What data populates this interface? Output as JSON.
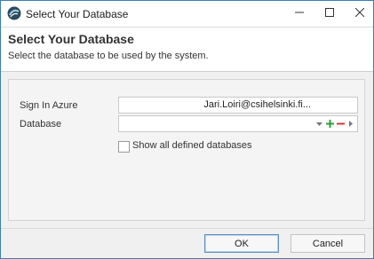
{
  "window": {
    "title": "Select Your Database",
    "accent_color": "#3c7fb1"
  },
  "icons": {
    "app": "app-logo-icon",
    "minimize": "minimize-icon",
    "maximize": "maximize-icon",
    "close": "close-icon",
    "dropdown": "chevron-down-icon",
    "add": "plus-icon",
    "remove": "minus-icon",
    "next": "chevron-right-icon"
  },
  "header": {
    "title": "Select Your Database",
    "subtitle": "Select the database to be used by the system."
  },
  "form": {
    "sign_in_label": "Sign In Azure",
    "sign_in_value": "Jari.Loiri@csihelsinki.fi...",
    "database_label": "Database",
    "database_value": "",
    "show_all_label": "Show all defined databases",
    "show_all_checked": false
  },
  "buttons": {
    "ok_label": "OK",
    "cancel_label": "Cancel"
  },
  "colors": {
    "add_green": "#2e9e3a",
    "remove_red": "#d43a3a"
  }
}
